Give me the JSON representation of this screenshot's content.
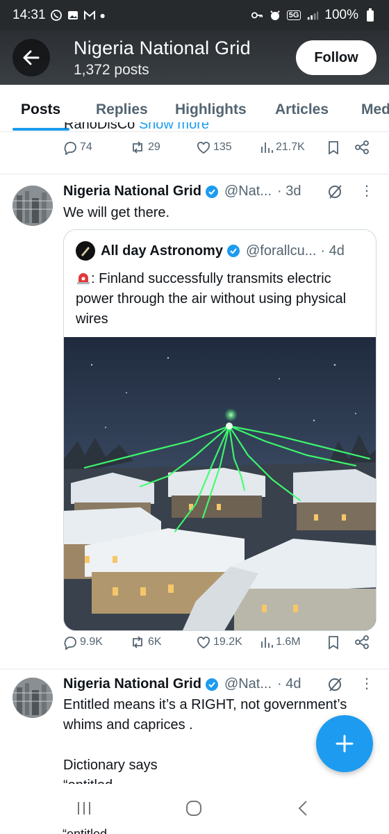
{
  "status_bar": {
    "time": "14:31",
    "battery": "100%",
    "network": "5G"
  },
  "header": {
    "title": "Nigeria National Grid",
    "post_count": "1,372 posts",
    "follow_label": "Follow"
  },
  "tabs": [
    "Posts",
    "Replies",
    "Highlights",
    "Articles",
    "Med"
  ],
  "prev_post": {
    "cut_text": "RanoDisCo",
    "show_more": "Show more",
    "stats": {
      "replies": "74",
      "reposts": "29",
      "likes": "135",
      "views": "21.7K"
    }
  },
  "post1": {
    "author": "Nigeria National Grid",
    "handle": "@Nat...",
    "time": "· 3d",
    "text": "We will get there.",
    "quote": {
      "author": "All day Astronomy",
      "handle": "@forallcu...",
      "time": "· 4d",
      "text": ": Finland successfully transmits electric power through the air without using physical wires"
    },
    "stats": {
      "replies": "9.9K",
      "reposts": "6K",
      "likes": "19.2K",
      "views": "1.6M"
    }
  },
  "post2": {
    "author": "Nigeria National Grid",
    "handle": "@Nat...",
    "time": "· 4d",
    "text_line1": "Entitled means it’s a RIGHT, not government’s",
    "text_line2": "whims and caprices .",
    "text_line3": "Dictionary says",
    "text_line4": "“entitled"
  },
  "bottom_ghost": "“entitled",
  "colors": {
    "accent": "#1d9bf0",
    "verified": "#1d9bf0"
  }
}
